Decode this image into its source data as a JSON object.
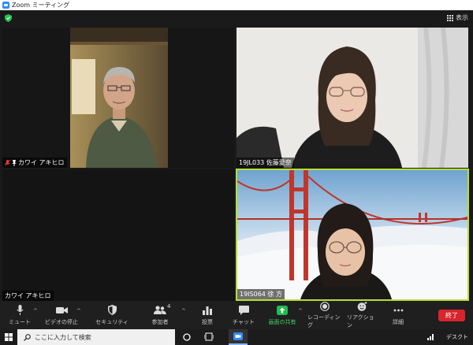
{
  "window": {
    "title": "Zoom ミーティング"
  },
  "header": {
    "view_label": "表示"
  },
  "participants": [
    {
      "name": "カワイ アキヒロ",
      "muted": true,
      "pinned": true
    },
    {
      "name": "19JL033 佐藤愛奈"
    },
    {
      "name": "カワイ アキヒロ"
    },
    {
      "name": "19IS064 徐 方",
      "active_speaker": true
    }
  ],
  "toolbar": {
    "mute_label": "ミュート",
    "video_label": "ビデオの停止",
    "security_label": "セキュリティ",
    "participants_label": "参加者",
    "participants_count": "4",
    "poll_label": "投票",
    "chat_label": "チャット",
    "share_label": "画面の共有",
    "record_label": "レコーディング",
    "reaction_label": "リアクション",
    "more_label": "詳細",
    "end_label": "終了"
  },
  "taskbar": {
    "search_placeholder": "ここに入力して検索",
    "desktop_label": "デスクト"
  },
  "colors": {
    "end_button": "#d9242c",
    "active_speaker_border": "#b6df35",
    "share_green": "#1fbd4f",
    "zoom_blue": "#2d8cff"
  }
}
